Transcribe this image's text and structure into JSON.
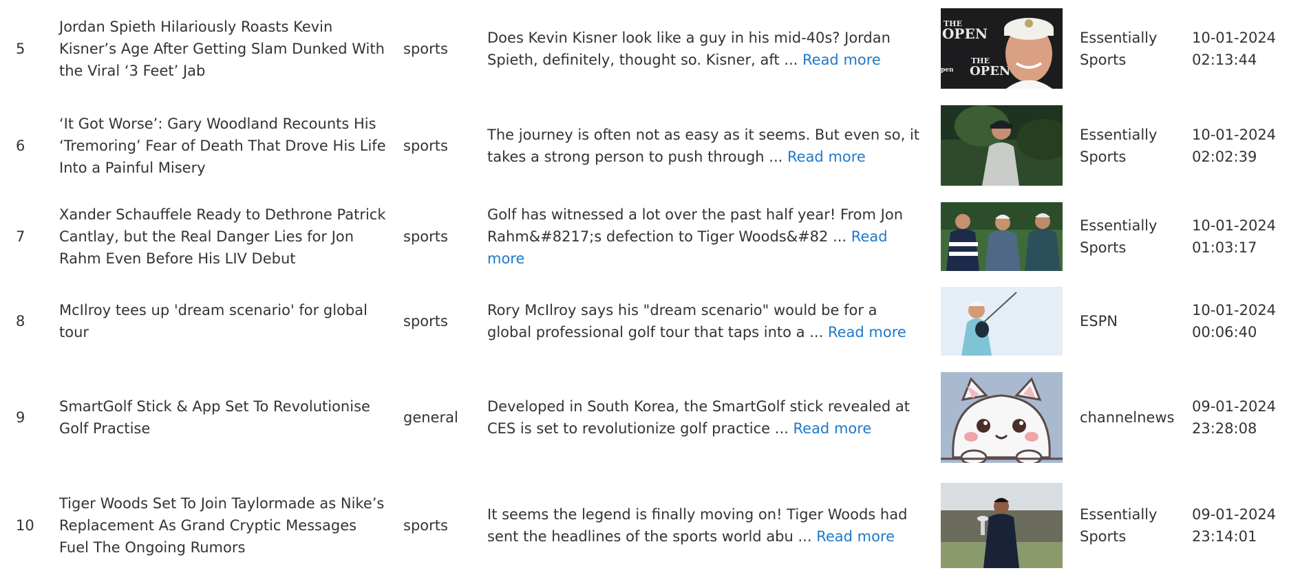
{
  "rows": [
    {
      "num": "5",
      "title": "Jordan Spieth Hilariously Roasts Kevin Kisner’s Age After Getting Slam Dunked With the Viral ‘3 Feet’ Jab",
      "category": "sports",
      "desc": "Does Kevin Kisner look like a guy in his mid-40s? Jordan Spieth, definitely, thought so. Kisner, aft ...",
      "read_more": "Read more",
      "image_alt": "golfer-portrait-open-backdrop",
      "source": "Essentially Sports",
      "date": "10-01-2024 02:13:44"
    },
    {
      "num": "6",
      "title": "‘It Got Worse’: Gary Woodland Recounts His ‘Tremoring’ Fear of Death That Drove His Life Into a Painful Misery",
      "category": "sports",
      "desc": "The journey is often not as easy as it seems. But even so, it takes a strong person to push through ...",
      "read_more": "Read more",
      "image_alt": "golfer-walking-course",
      "source": "Essentially Sports",
      "date": "10-01-2024 02:02:39"
    },
    {
      "num": "7",
      "title": "Xander Schauffele Ready to Dethrone Patrick Cantlay, but the Real Danger Lies for Jon Rahm Even Before His LIV Debut",
      "category": "sports",
      "desc": "Golf has witnessed a lot over the past half year! From Jon Rahm&#8217;s defection to Tiger Woods&#82 ...",
      "read_more": "Read more",
      "image_alt": "three-golfers",
      "source": "Essentially Sports",
      "date": "10-01-2024 01:03:17"
    },
    {
      "num": "8",
      "title": "McIlroy tees up 'dream scenario' for global tour",
      "category": "sports",
      "desc": "Rory McIlroy says his \"dream scenario\" would be for a global professional golf tour that taps into a ...",
      "read_more": "Read more",
      "image_alt": "golfer-swing-sky",
      "source": "ESPN",
      "date": "10-01-2024 00:06:40"
    },
    {
      "num": "9",
      "title": "SmartGolf Stick & App Set To Revolutionise Golf Practise",
      "category": "general",
      "desc": "Developed in South Korea, the SmartGolf stick revealed at CES is set to revolutionize golf practice ...",
      "read_more": "Read more",
      "image_alt": "cartoon-cat-placeholder",
      "source": "channelnews",
      "date": "09-01-2024 23:28:08"
    },
    {
      "num": "10",
      "title": "Tiger Woods Set To Join Taylormade as Nike’s Replacement As Grand Cryptic Messages Fuel The Ongoing Rumors",
      "category": "sports",
      "desc": "It seems the legend is finally moving on! Tiger Woods had sent the headlines of the sports world abu ...",
      "read_more": "Read more",
      "image_alt": "golfer-holding-trophy",
      "source": "Essentially Sports",
      "date": "09-01-2024 23:14:01"
    }
  ],
  "colors": {
    "link": "#1f78c8",
    "text": "#333333"
  }
}
